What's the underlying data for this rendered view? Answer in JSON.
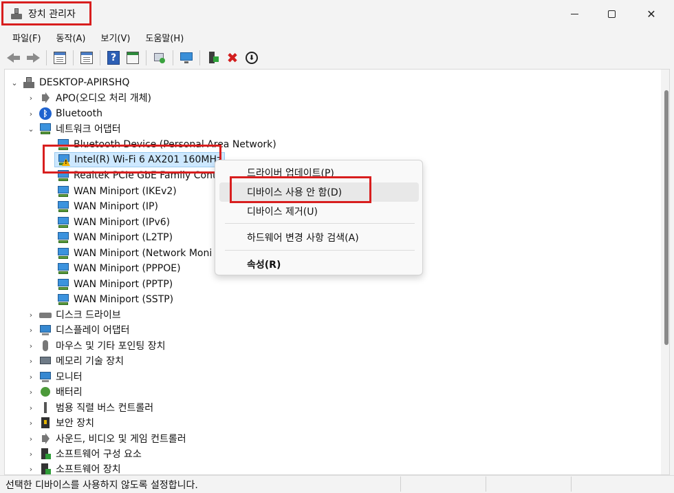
{
  "window": {
    "title": "장치 관리자",
    "minimize_glyph": "",
    "close_glyph": "✕"
  },
  "menu": [
    {
      "label": "파일(F)"
    },
    {
      "label": "동작(A)"
    },
    {
      "label": "보기(V)"
    },
    {
      "label": "도움말(H)"
    }
  ],
  "toolbar": {
    "help_glyph": "?",
    "delete_glyph": "✖",
    "download_glyph": "⬇"
  },
  "tree": {
    "root": "DESKTOP-APIRSHQ",
    "categories": [
      {
        "label": "APO(오디오 처리 개체)"
      },
      {
        "label": "Bluetooth"
      },
      {
        "label": "네트워크 어댑터"
      },
      {
        "label": "디스크 드라이브"
      },
      {
        "label": "디스플레이 어댑터"
      },
      {
        "label": "마우스 및 기타 포인팅 장치"
      },
      {
        "label": "메모리 기술 장치"
      },
      {
        "label": "모니터"
      },
      {
        "label": "배터리"
      },
      {
        "label": "범용 직렬 버스 컨트롤러"
      },
      {
        "label": "보안 장치"
      },
      {
        "label": "사운드, 비디오 및 게임 컨트롤러"
      },
      {
        "label": "소프트웨어 구성 요소"
      },
      {
        "label": "소프트웨어 장치"
      }
    ],
    "network_devices": [
      {
        "label": "Bluetooth Device (Personal Area Network)"
      },
      {
        "label": "Intel(R) Wi-Fi 6 AX201 160MHz"
      },
      {
        "label": "Realtek PCIe GbE Family Contro"
      },
      {
        "label": "WAN Miniport (IKEv2)"
      },
      {
        "label": "WAN Miniport (IP)"
      },
      {
        "label": "WAN Miniport (IPv6)"
      },
      {
        "label": "WAN Miniport (L2TP)"
      },
      {
        "label": "WAN Miniport (Network Moni"
      },
      {
        "label": "WAN Miniport (PPPOE)"
      },
      {
        "label": "WAN Miniport (PPTP)"
      },
      {
        "label": "WAN Miniport (SSTP)"
      }
    ],
    "bt_glyph": "ᛒ",
    "warn_glyph": "!",
    "chev_open": "⌄",
    "chev_closed": "›"
  },
  "context_menu": {
    "items": [
      {
        "label": "드라이버 업데이트(P)"
      },
      {
        "label": "디바이스 사용 안 함(D)"
      },
      {
        "label": "디바이스 제거(U)"
      },
      {
        "label": "하드웨어 변경 사항 검색(A)"
      },
      {
        "label": "속성(R)"
      }
    ]
  },
  "status": {
    "text": "선택한 디바이스를 사용하지 않도록 설정합니다."
  },
  "colors": {
    "highlight_border": "#d81e1e",
    "selection": "#cde8ff"
  }
}
